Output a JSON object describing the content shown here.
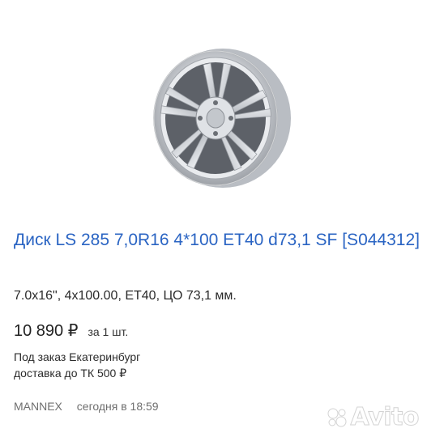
{
  "listing": {
    "title": "Диск LS 285 7,0R16 4*100 ET40 d73,1 SF [S044312]",
    "specs": "7.0x16\", 4x100.00, ET40, ЦО 73,1 мм.",
    "price": "10 890 ₽",
    "price_unit": "за 1 шт.",
    "availability": "Под заказ Екатеринбург",
    "delivery": "доставка до ТК 500 ₽",
    "seller": "MANNEX",
    "posted": "сегодня в 18:59",
    "image_icon": "alloy-wheel-photo"
  },
  "watermark": {
    "text": "Avito",
    "icon": "avito-dots-logo"
  },
  "colors": {
    "title_link": "#2a64c3",
    "text": "#2b2b2b",
    "muted": "#6f6f6f"
  }
}
